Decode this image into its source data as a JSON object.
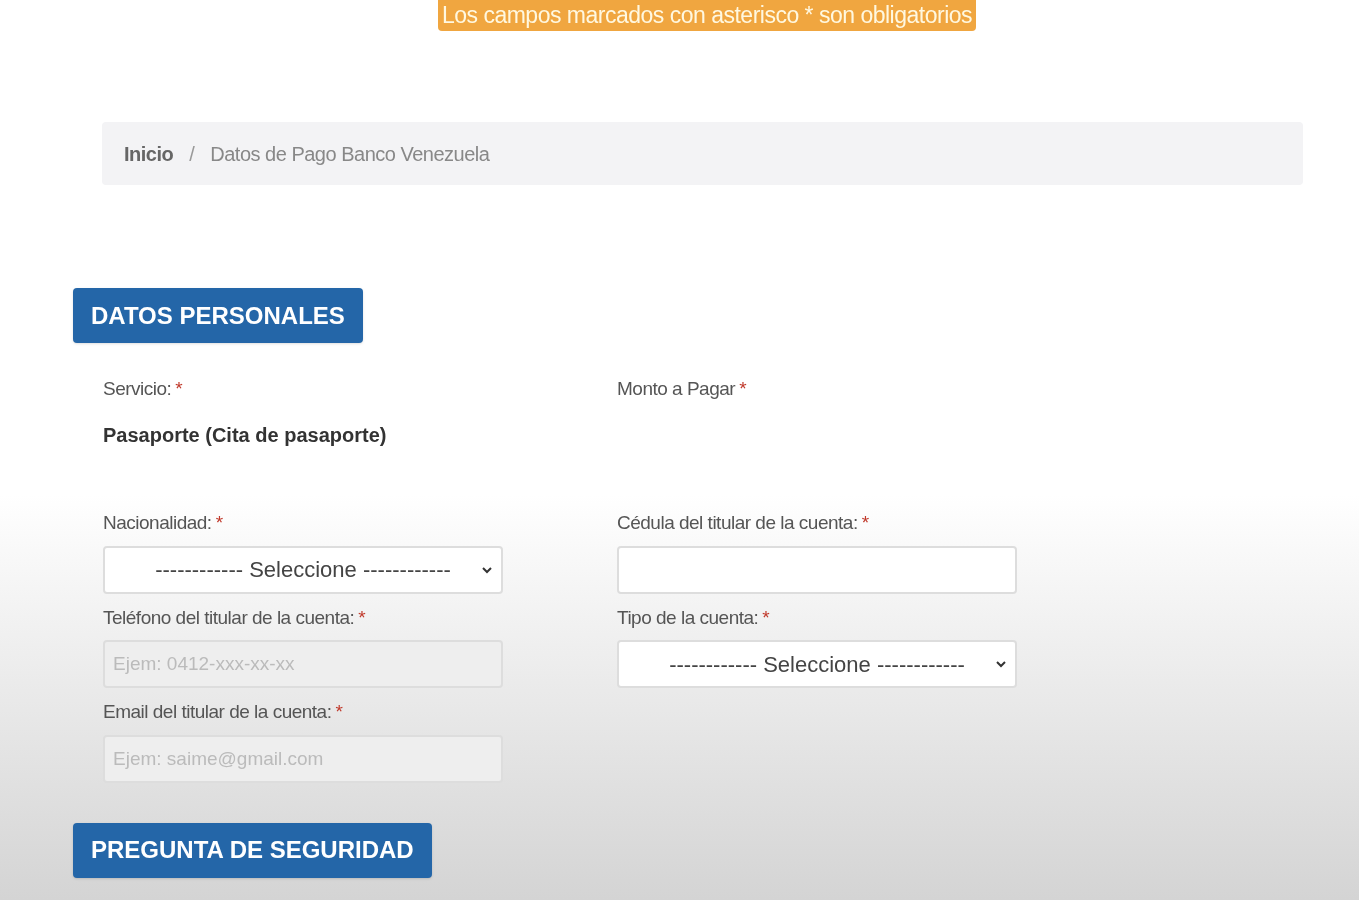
{
  "notice": "Los campos marcados con asterisco * son obligatorios",
  "breadcrumb": {
    "items": [
      "Inicio",
      "Datos de Pago Banco Venezuela"
    ],
    "separator": "/"
  },
  "sections": [
    {
      "title": "DATOS PERSONALES"
    },
    {
      "title": "PREGUNTA DE SEGURIDAD"
    }
  ],
  "info": [
    {
      "label": "Servicio:",
      "required": "*",
      "value": "Pasaporte (Cita de pasaporte)"
    },
    {
      "label": "Monto a Pagar",
      "required": "*"
    }
  ],
  "field_rows": [
    [
      {
        "kind": "select",
        "label": "Nacionalidad:",
        "required": "*",
        "value": "------------ Seleccione ------------"
      },
      {
        "kind": "text",
        "label": "Cédula del titular de la cuenta:",
        "required": "*"
      }
    ],
    [
      {
        "kind": "text",
        "label": "Teléfono del titular de la cuenta:",
        "required": "*",
        "placeholder": "Ejem: 0412-xxx-xx-xx"
      },
      {
        "kind": "select",
        "label": "Tipo de la cuenta:",
        "required": "*",
        "value": "------------ Seleccione ------------"
      }
    ],
    [
      {
        "kind": "text",
        "label": "Email del titular de la cuenta:",
        "required": "*",
        "placeholder": "Ejem: saime@gmail.com"
      }
    ]
  ]
}
